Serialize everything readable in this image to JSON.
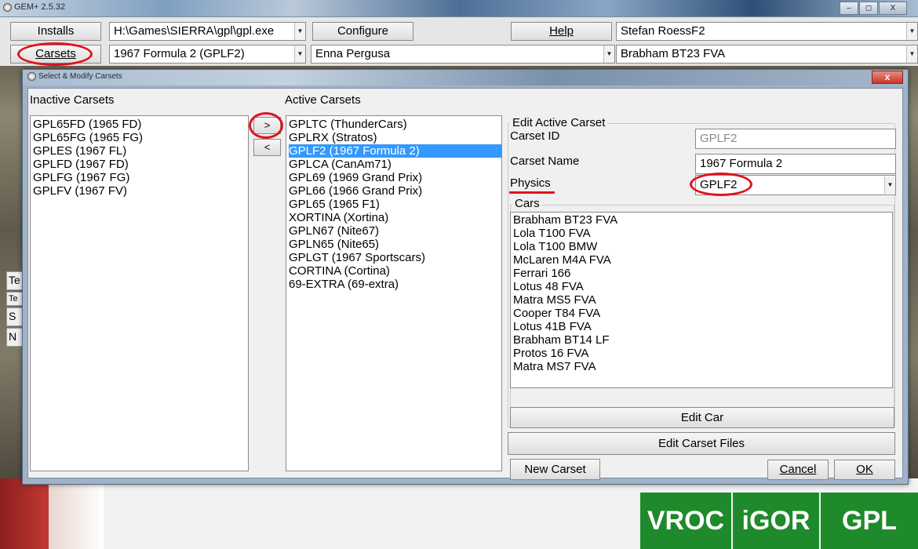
{
  "window": {
    "title": "GEM+ 2.5.32",
    "min": "–",
    "max": "◻",
    "close": "X"
  },
  "toolbar": {
    "installs_label": "Installs",
    "install_path": "H:\\Games\\SIERRA\\gpl\\gpl.exe",
    "configure_label": "Configure",
    "help_label": "Help",
    "driver": "Stefan RoessF2",
    "carsets_label": "Carsets",
    "carset": "1967 Formula 2 (GPLF2)",
    "track": "Enna Pergusa",
    "car": "Brabham BT23 FVA"
  },
  "background": {
    "logos": [
      "VROC",
      "iGOR",
      "GPL"
    ],
    "scraps_left": [
      "Te",
      "Te",
      "S",
      "N"
    ]
  },
  "dialog": {
    "title": "Select & Modify Carsets",
    "close": "x",
    "inactive_label": "Inactive Carsets",
    "active_label": "Active Carsets",
    "move_right": ">",
    "move_left": "<",
    "inactive": [
      "GPL65FD (1965 FD)",
      "GPL65FG (1965 FG)",
      "GPLES (1967 FL)",
      "GPLFD (1967 FD)",
      "GPLFG (1967 FG)",
      "GPLFV (1967 FV)"
    ],
    "active": [
      "GPLTC (ThunderCars)",
      "GPLRX (Stratos)",
      "GPLF2 (1967 Formula 2)",
      "GPLCA (CanAm71)",
      "GPL69 (1969 Grand Prix)",
      "GPL66 (1966 Grand Prix)",
      "GPL65 (1965 F1)",
      "XORTINA (Xortina)",
      "GPLN67 (Nite67)",
      "GPLN65 (Nite65)",
      "GPLGT (1967 Sportscars)",
      "CORTINA (Cortina)",
      "69-EXTRA (69-extra)"
    ],
    "active_selected_index": 2,
    "edit": {
      "group_label": "Edit Active Carset",
      "carset_id_label": "Carset ID",
      "carset_id": "GPLF2",
      "carset_name_label": "Carset Name",
      "carset_name": "1967 Formula 2",
      "physics_label": "Physics",
      "physics": "GPLF2",
      "cars_label": "Cars",
      "cars": [
        "Brabham BT23 FVA",
        "Lola T100 FVA",
        "Lola T100 BMW",
        "McLaren M4A FVA",
        "Ferrari 166",
        "Lotus 48 FVA",
        "Matra MS5 FVA",
        "Cooper T84 FVA",
        "Lotus 41B FVA",
        "Brabham BT14 LF",
        "Protos 16 FVA",
        "Matra MS7 FVA"
      ],
      "edit_car_label": "Edit Car",
      "edit_files_label": "Edit Carset Files"
    },
    "new_carset_label": "New Carset",
    "cancel_label": "Cancel",
    "ok_label": "OK"
  },
  "colors": {
    "highlight": "#3399ff",
    "annotation": "#e0121e",
    "logo_green": "#1f8a2c"
  }
}
